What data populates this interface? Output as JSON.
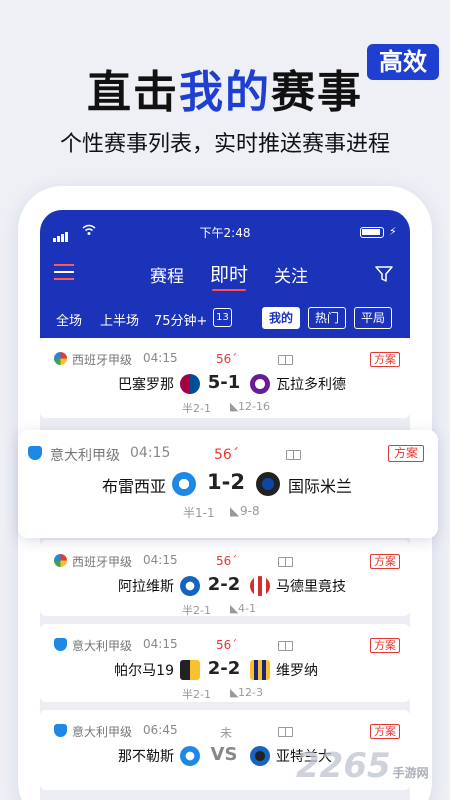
{
  "promo": {
    "headline_pre": "直击",
    "headline_highlight": "我的",
    "headline_post": "赛事",
    "badge": "高效",
    "subtitle": "个性赛事列表，实时推送赛事进程"
  },
  "status_bar": {
    "time": "下午2:48"
  },
  "nav": {
    "tabs": [
      {
        "label": "赛程",
        "active": false
      },
      {
        "label": "即时",
        "active": true
      },
      {
        "label": "关注",
        "active": false
      }
    ]
  },
  "sub_filters": {
    "phases": [
      "全场",
      "上半场",
      "75分钟+"
    ],
    "calendar_day": "13",
    "pills": [
      {
        "label": "我的",
        "selected": true
      },
      {
        "label": "热门",
        "selected": false
      },
      {
        "label": "平局",
        "selected": false
      }
    ]
  },
  "matches": [
    {
      "league": "西班牙甲级",
      "time": "04:15",
      "minute": "56´",
      "plan": "方案",
      "home": "巴塞罗那",
      "score": "5-1",
      "away": "瓦拉多利德",
      "half": "半2-1",
      "corners": "12-16"
    },
    {
      "league": "意大利甲级",
      "time": "04:15",
      "minute": "56´",
      "plan": "方案",
      "home": "布雷西亚",
      "score": "1-2",
      "away": "国际米兰",
      "half": "半1-1",
      "corners": "9-8"
    },
    {
      "league": "西班牙甲级",
      "time": "04:15",
      "minute": "56´",
      "plan": "方案",
      "home": "阿拉维斯",
      "score": "2-2",
      "away": "马德里竟技",
      "half": "半2-1",
      "corners": "4-1"
    },
    {
      "league": "意大利甲级",
      "time": "04:15",
      "minute": "56´",
      "plan": "方案",
      "home": "帕尔马19",
      "score": "2-2",
      "away": "维罗纳",
      "half": "半2-1",
      "corners": "12-3"
    },
    {
      "league": "意大利甲级",
      "time": "06:45",
      "minute": "未",
      "plan": "方案",
      "home": "那不勒斯",
      "score": "VS",
      "away": "亚特兰大",
      "half": "",
      "corners": ""
    }
  ],
  "watermark": {
    "brand": "2265",
    "suffix": "手游网"
  },
  "colors": {
    "brand_blue": "#1b33b8",
    "headline_blue": "#1f3fd1",
    "live_red": "#e53935"
  }
}
